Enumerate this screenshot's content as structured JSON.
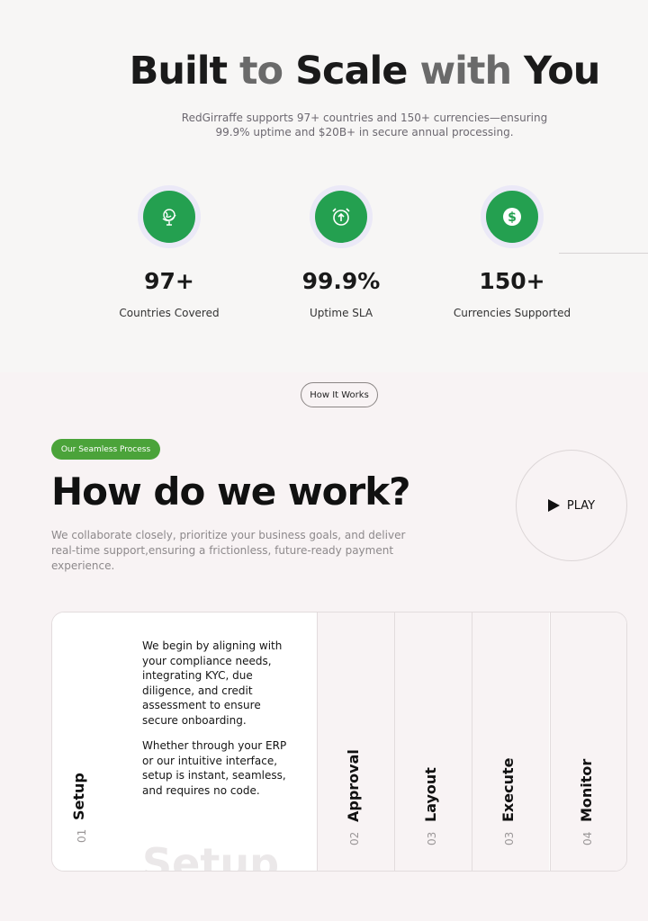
{
  "hero": {
    "title_parts": [
      "Built",
      " to ",
      "Scale",
      " with ",
      "You"
    ],
    "subtitle": "RedGirraffe supports 97+ countries and 150+ currencies—ensuring 99.9% uptime and $20B+ in secure annual processing."
  },
  "stats": [
    {
      "icon": "globe-icon",
      "value": "97+",
      "label": "Countries Covered"
    },
    {
      "icon": "alarm-clock-icon",
      "value": "99.9%",
      "label": "Uptime SLA"
    },
    {
      "icon": "dollar-icon",
      "value": "150+",
      "label": "Currencies Supported"
    }
  ],
  "how": {
    "pill": "How It Works",
    "badge": "Our Seamless Process",
    "title": "How do we work?",
    "description": "We collaborate closely, prioritize your business goals, and deliver real-time support,ensuring a frictionless, future-ready payment experience.",
    "play_label": "PLAY"
  },
  "steps": {
    "active": {
      "number": "01",
      "name": "Setup",
      "paragraph1": "We begin by aligning with your compliance needs, integrating KYC, due diligence, and credit assessment to ensure secure onboarding.",
      "paragraph2": "Whether through your ERP or our intuitive interface, setup is instant, seamless, and requires no code.",
      "ghost": "Setup"
    },
    "tabs": [
      {
        "number": "02",
        "name": "Approval"
      },
      {
        "number": "03",
        "name": "Layout"
      },
      {
        "number": "03",
        "name": "Execute"
      },
      {
        "number": "04",
        "name": "Monitor"
      }
    ]
  },
  "colors": {
    "accent_green": "#24a050",
    "badge_green": "#4ba33a"
  }
}
